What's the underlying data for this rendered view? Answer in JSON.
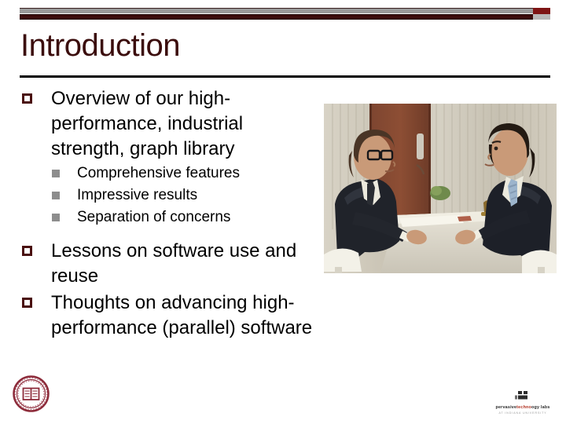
{
  "slide": {
    "title": "Introduction",
    "accent_color": "#3b0d0d",
    "bar_gray": "#9a9a9a",
    "bar_maroon": "#3c0d0d"
  },
  "bullets": [
    {
      "level": 1,
      "marker": "hollow-square-marker",
      "text": "Overview of our high-performance, industrial strength, graph library"
    },
    {
      "level": 2,
      "marker": "filled-square-marker",
      "text": "Comprehensive features"
    },
    {
      "level": 2,
      "marker": "filled-square-marker",
      "text": "Impressive results"
    },
    {
      "level": 2,
      "marker": "filled-square-marker",
      "text": "Separation of concerns"
    },
    {
      "level": 1,
      "marker": "hollow-square-marker",
      "text": "Lessons on software use and reuse"
    },
    {
      "level": 1,
      "marker": "hollow-square-marker",
      "text": "Thoughts on advancing high-performance (parallel) software"
    }
  ],
  "photo": {
    "alt": "Two men in dark suits seated at a white table facing each other in an office, wood door and striped wall behind",
    "icon": "photo-placeholder-icon"
  },
  "logos": {
    "seal": {
      "name": "university-seal-icon",
      "color": "#8d2b3a"
    },
    "corporate": {
      "name": "pervasive technology labs",
      "name_part_1": "pervasive",
      "name_part_2": "techno",
      "name_part_3": "ogy labs",
      "subtitle": "AT INDIANA UNIVERSITY",
      "mark": "pti-block-mark-icon"
    }
  }
}
